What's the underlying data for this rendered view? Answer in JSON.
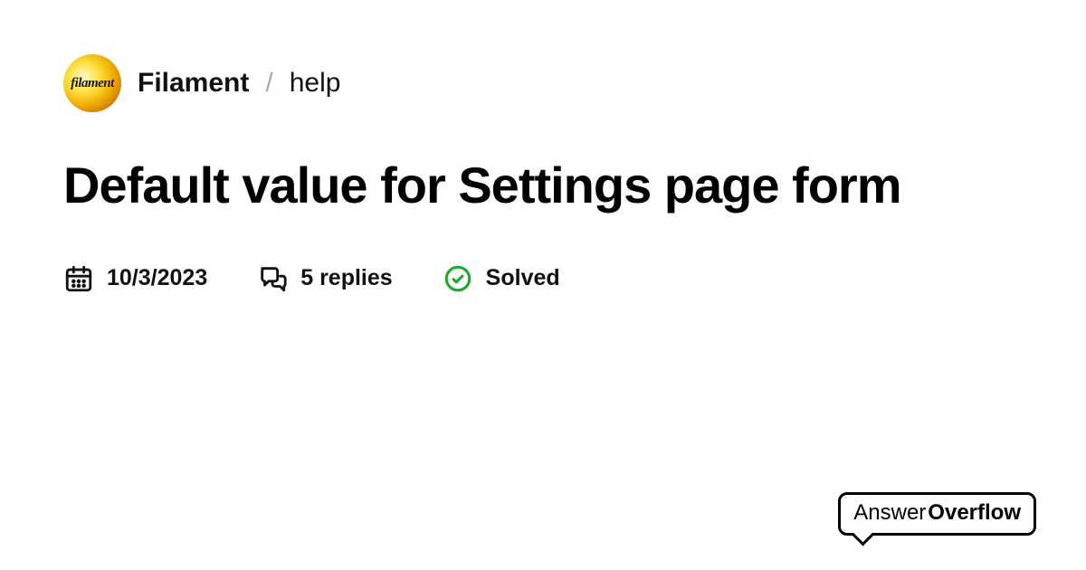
{
  "breadcrumb": {
    "avatar_label": "filament",
    "server": "Filament",
    "separator": "/",
    "channel": "help"
  },
  "title": "Default value for Settings page form",
  "meta": {
    "date": "10/3/2023",
    "replies": "5 replies",
    "status": "Solved"
  },
  "colors": {
    "status_green": "#1fa82e"
  },
  "brand": {
    "part1": "Answer",
    "part2": "Overflow"
  }
}
